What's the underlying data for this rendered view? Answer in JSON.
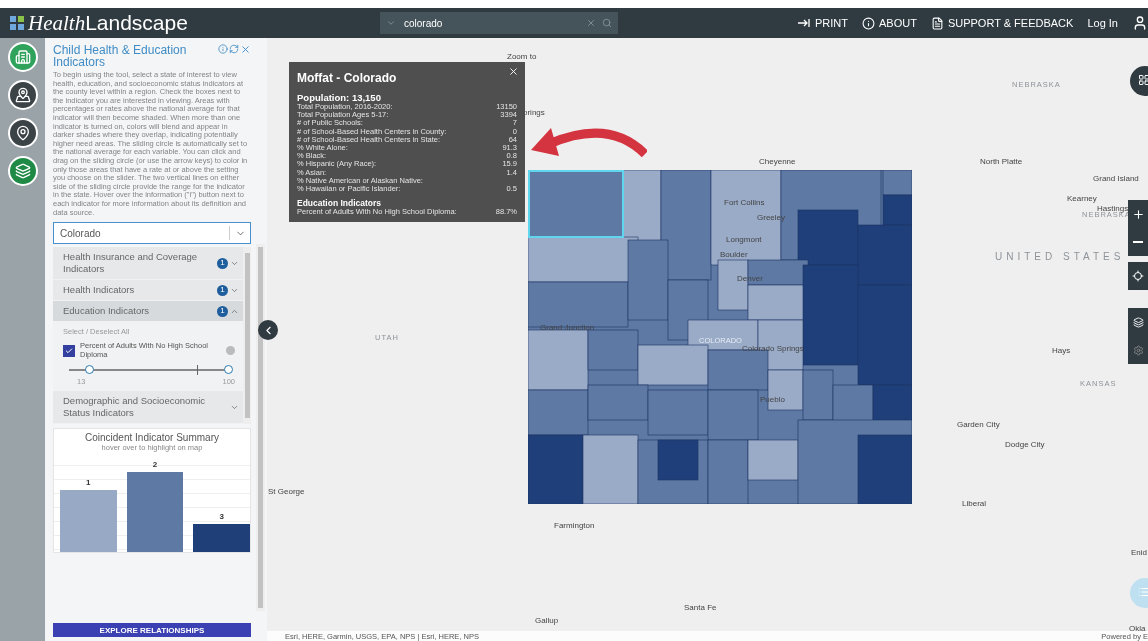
{
  "header": {
    "logo": {
      "italic": "Health",
      "rest": "Landscape"
    },
    "search": {
      "value": "colorado"
    },
    "links": [
      {
        "label": "PRINT",
        "kind": "print"
      },
      {
        "label": "ABOUT",
        "kind": "about"
      },
      {
        "label": "SUPPORT & FEEDBACK",
        "kind": "support"
      },
      {
        "label": "Log In",
        "kind": "login"
      }
    ]
  },
  "rail": [
    {
      "kind": "building",
      "color": "#2fa35c"
    },
    {
      "kind": "map",
      "color": "#3b4347"
    },
    {
      "kind": "pin",
      "color": "#3b4347"
    },
    {
      "kind": "layers",
      "color": "#1f8a45"
    }
  ],
  "panel": {
    "title": "Child Health & Education Indicators",
    "intro": "To begin using the tool, select a state of interest to view health, education, and socioeconomic status indicators at the county level within a region. Check the boxes next to the indicator you are interested in viewing. Areas with percentages or rates above the national average for that indicator will then become shaded. When more than one indicator is turned on, colors will blend and appear in darker shades where they overlap, indicating potentially higher need areas. The sliding circle is automatically set to the national average for each variable. You can click and drag on the sliding circle (or use the arrow keys) to color in only those areas that have a rate at or above the setting you choose on the slider. The two vertical lines on either side of the sliding circle provide the range for the indicator in the state. Hover over the information (\"i\") button next to each indicator for more information about its definition and data source.",
    "state_select": {
      "value": "Colorado"
    },
    "sections": [
      {
        "label": "Health Insurance and Coverage Indicators",
        "badge": "1",
        "expanded": false
      },
      {
        "label": "Health Indicators",
        "badge": "1",
        "expanded": false
      },
      {
        "label": "Education Indicators",
        "badge": "1",
        "expanded": true,
        "select_all": "Select / Deselect All",
        "indicators": [
          {
            "label": "Percent of Adults With No High School Diploma",
            "checked": true,
            "thumbs": [
              {
                "level": 0.13
              },
              {
                "level": 1
              }
            ],
            "min_label": "13",
            "max_label": "100"
          }
        ]
      },
      {
        "label": "Demographic and Socioeconomic Status Indicators",
        "expanded": false
      }
    ],
    "summary": {
      "title": "Coincident Indicator Summary",
      "subtitle": "hover over to highlight on map",
      "bars": [
        {
          "label": "1",
          "color": "#98a9c6"
        },
        {
          "label": "2",
          "color": "#5e79a4"
        },
        {
          "label": "3",
          "color": "#1f3f78"
        }
      ]
    },
    "button": "EXPLORE RELATIONSHIPS"
  },
  "tooltip": {
    "title": "Moffat - Colorado",
    "population": "Population: 13,150",
    "rows": [
      {
        "label": "Total Population, 2016-2020:",
        "value": "13150"
      },
      {
        "label": "Total Population Ages 5-17:",
        "value": "3394"
      },
      {
        "label": "# of Public Schools:",
        "value": "7"
      },
      {
        "label": "# of School-Based Health Centers in County:",
        "value": "0"
      },
      {
        "label": "# of School-Based Health Centers in State:",
        "value": "64"
      },
      {
        "label": "% White Alone:",
        "value": "91.3"
      },
      {
        "label": "% Black:",
        "value": "0.8"
      },
      {
        "label": "% Hispanic (Any Race):",
        "value": "15.9"
      },
      {
        "label": "% Asian:",
        "value": "1.4"
      },
      {
        "label": "% Native American or Alaskan Native:",
        "value": ""
      },
      {
        "label": "% Hawaiian or Pacific Islander:",
        "value": "0.5"
      }
    ],
    "section": "Education Indicators",
    "section_rows": [
      {
        "label": "Percent of Adults With No High School Diploma:",
        "value": "88.7%"
      }
    ]
  },
  "map": {
    "labels": [
      {
        "text": "Zoom to",
        "kind": "city"
      },
      {
        "text": "prings",
        "kind": "city"
      },
      {
        "text": "NEBRASKA",
        "kind": "region"
      },
      {
        "text": "Cheyenne",
        "kind": "city"
      },
      {
        "text": "North Platte",
        "kind": "city"
      },
      {
        "text": "Grand Island",
        "kind": "city"
      },
      {
        "text": "Kearney",
        "kind": "city"
      },
      {
        "text": "Hastings",
        "kind": "city"
      },
      {
        "text": "NEBRASKA",
        "kind": "region"
      },
      {
        "text": "UNITED STATES",
        "kind": "country"
      },
      {
        "text": "Fort Collins",
        "kind": "city"
      },
      {
        "text": "Greeley",
        "kind": "city"
      },
      {
        "text": "Longmont",
        "kind": "city"
      },
      {
        "text": "Boulder",
        "kind": "city"
      },
      {
        "text": "Denver",
        "kind": "city"
      },
      {
        "text": "Grand Junction",
        "kind": "city"
      },
      {
        "text": "COLORADO",
        "kind": "overlay"
      },
      {
        "text": "Colorado Springs",
        "kind": "city"
      },
      {
        "text": "Pueblo",
        "kind": "city"
      },
      {
        "text": "UTAH",
        "kind": "region"
      },
      {
        "text": "Hays",
        "kind": "city"
      },
      {
        "text": "KANSAS",
        "kind": "region"
      },
      {
        "text": "Garden City",
        "kind": "city"
      },
      {
        "text": "Dodge City",
        "kind": "city"
      },
      {
        "text": "Liberal",
        "kind": "city"
      },
      {
        "text": "St George",
        "kind": "city"
      },
      {
        "text": "Farmington",
        "kind": "city"
      },
      {
        "text": "Santa Fe",
        "kind": "city"
      },
      {
        "text": "Gallup",
        "kind": "city"
      },
      {
        "text": "Enid",
        "kind": "city"
      },
      {
        "text": "Okla",
        "kind": "city"
      }
    ],
    "attribution": "Esri, HERE, Garmin, USGS, EPA, NPS | Esri, HERE, NPS",
    "powered_by": "Powered by E"
  }
}
